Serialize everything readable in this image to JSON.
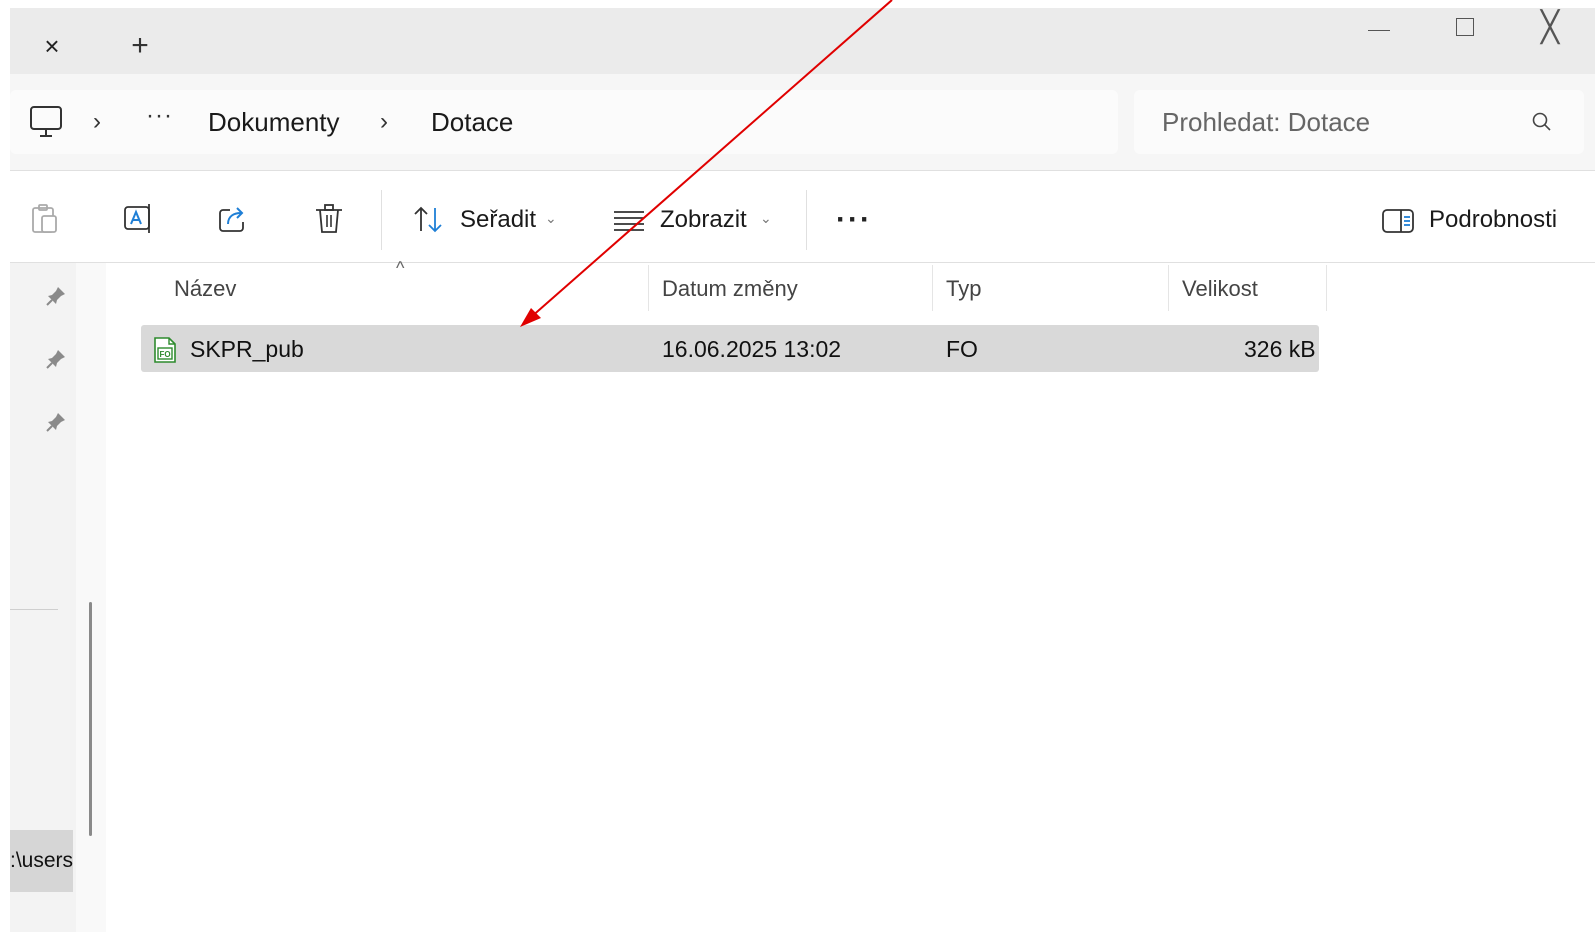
{
  "tabbar": {
    "close_glyph": "×",
    "new_glyph": "+",
    "window_close_glyph": "╳"
  },
  "address": {
    "more": "···",
    "chevron": "›",
    "crumbs": [
      "Dokumenty",
      "Dotace"
    ]
  },
  "search": {
    "placeholder": "Prohledat: Dotace"
  },
  "toolbar": {
    "sort_label": "Seřadit",
    "view_label": "Zobrazit",
    "more": "···",
    "details_label": "Podrobnosti",
    "dropdown_glyph": "⌄"
  },
  "nav": {
    "path_label": ":\\users"
  },
  "table": {
    "sort_indicator": "^",
    "columns": [
      "Název",
      "Datum změny",
      "Typ",
      "Velikost"
    ],
    "rows": [
      {
        "name": "SKPR_pub",
        "date": "16.06.2025 13:02",
        "type": "FO",
        "size": "326 kB",
        "selected": true
      }
    ]
  },
  "colors": {
    "selection": "#d9d9d9",
    "annotation_arrow": "#e00000",
    "icon_accent": "#1f7fd6",
    "file_icon_green": "#2e8b2e"
  },
  "icons": [
    "monitor-icon",
    "search-icon",
    "paste-icon",
    "rename-icon",
    "share-icon",
    "delete-icon",
    "sort-icon",
    "view-icon",
    "details-pane-icon",
    "pin-icon",
    "fo-file-icon"
  ]
}
